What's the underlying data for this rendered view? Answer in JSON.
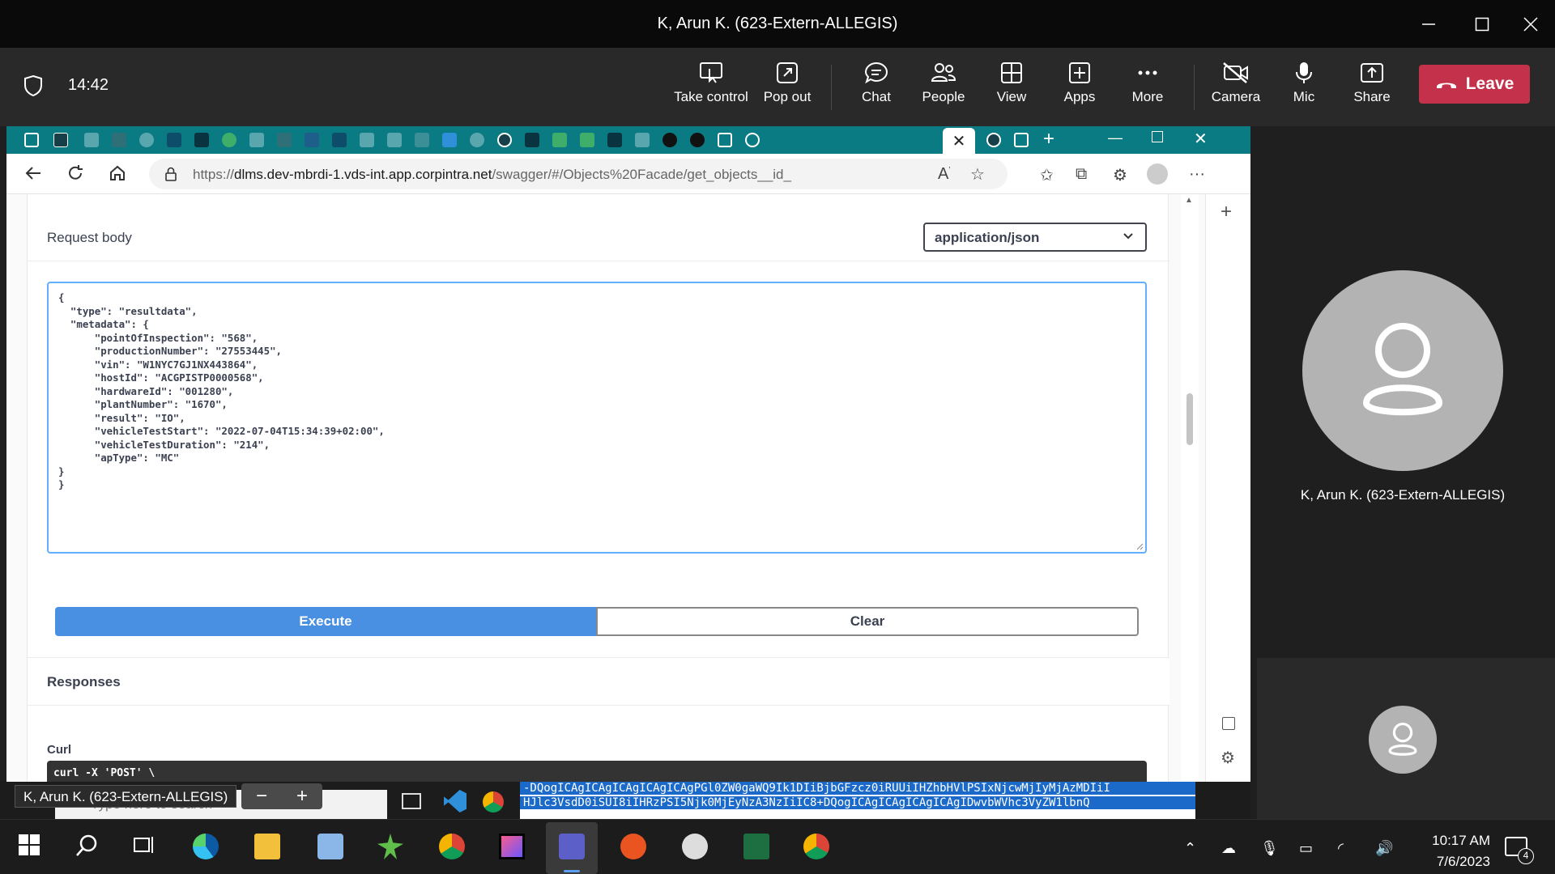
{
  "window": {
    "title": "K, Arun K. (623-Extern-ALLEGIS)"
  },
  "meeting": {
    "clock": "14:42",
    "tools": [
      {
        "label": "Take control",
        "icon": "take-control-icon"
      },
      {
        "label": "Pop out",
        "icon": "pop-out-icon"
      },
      {
        "label": "Chat",
        "icon": "chat-icon"
      },
      {
        "label": "People",
        "icon": "people-icon"
      },
      {
        "label": "View",
        "icon": "view-icon"
      },
      {
        "label": "Apps",
        "icon": "apps-icon"
      },
      {
        "label": "More",
        "icon": "more-icon"
      },
      {
        "label": "Camera",
        "icon": "camera-off-icon"
      },
      {
        "label": "Mic",
        "icon": "mic-icon"
      },
      {
        "label": "Share",
        "icon": "share-icon"
      }
    ],
    "leave_label": "Leave",
    "leave_color": "#c4314b"
  },
  "browser": {
    "url_prefix": "https://",
    "url_host": "dlms.dev-mbrdi-1.vds-int.app.corpintra.net",
    "url_path": "/swagger/#/Objects%20Facade/get_objects__id_",
    "tab_color": "#0a7b83"
  },
  "swagger": {
    "request_body_label": "Request body",
    "content_type": "application/json",
    "json_body": "{\n  \"type\": \"resultdata\",\n  \"metadata\": {\n      \"pointOfInspection\": \"568\",\n      \"productionNumber\": \"27553445\",\n      \"vin\": \"W1NYC7GJ1NX443864\",\n      \"hostId\": \"ACGPISTP0000568\",\n      \"hardwareId\": \"001280\",\n      \"plantNumber\": \"1670\",\n      \"result\": \"IO\",\n      \"vehicleTestStart\": \"2022-07-04T15:34:39+02:00\",\n      \"vehicleTestDuration\": \"214\",\n      \"apType\": \"MC\"\n}\n}",
    "execute_label": "Execute",
    "clear_label": "Clear",
    "responses_label": "Responses",
    "curl_label": "Curl",
    "curl_cmd": "curl -X 'POST' \\",
    "accent_color": "#4990e2"
  },
  "shared_taskbar": {
    "tooltip": "K, Arun K. (623-Extern-ALLEGIS)",
    "search_placeholder": "Type here to search",
    "highlight_lines": [
      "-DQogICAgICAgICAgICAgICAgPGl0ZW0gaWQ9Ik1DIiBjbGFzcz0iRUUiIHZhbHVlPSIxNjcwMjIyMjAzMDIiI",
      "HJlc3VsdD0iSUI8iIHRzPSI5Njk0MjEyNzA3NzIiIC8+DQogICAgICAgICAgICAgIDwvbWVhc3VyZW1lbnQ"
    ]
  },
  "participants": {
    "main_name": "K, Arun K. (623-Extern-ALLEGIS)"
  },
  "taskbar": {
    "time": "10:17 AM",
    "date": "7/6/2023",
    "notification_count": "4"
  }
}
